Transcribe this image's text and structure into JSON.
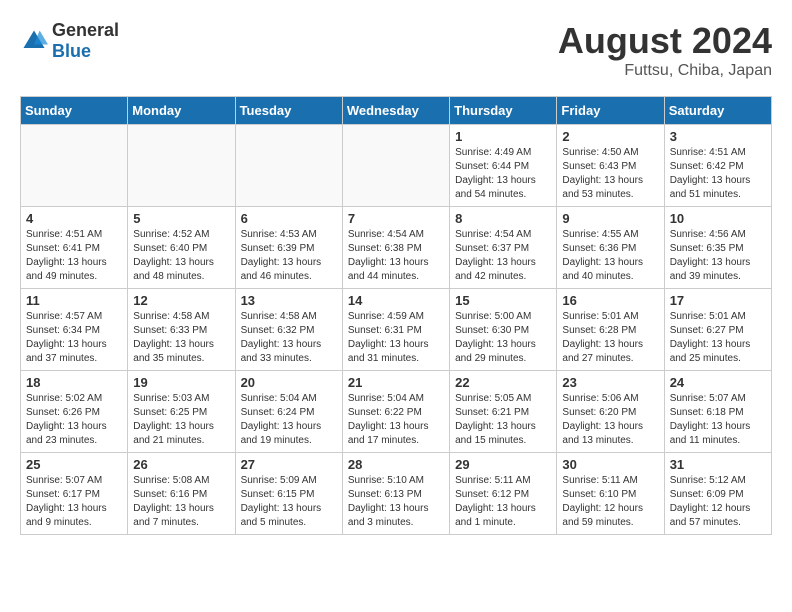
{
  "logo": {
    "general": "General",
    "blue": "Blue"
  },
  "title": "August 2024",
  "subtitle": "Futtsu, Chiba, Japan",
  "headers": [
    "Sunday",
    "Monday",
    "Tuesday",
    "Wednesday",
    "Thursday",
    "Friday",
    "Saturday"
  ],
  "weeks": [
    [
      {
        "day": "",
        "sunrise": "",
        "sunset": "",
        "daylight": ""
      },
      {
        "day": "",
        "sunrise": "",
        "sunset": "",
        "daylight": ""
      },
      {
        "day": "",
        "sunrise": "",
        "sunset": "",
        "daylight": ""
      },
      {
        "day": "",
        "sunrise": "",
        "sunset": "",
        "daylight": ""
      },
      {
        "day": "1",
        "sunrise": "Sunrise: 4:49 AM",
        "sunset": "Sunset: 6:44 PM",
        "daylight": "Daylight: 13 hours and 54 minutes."
      },
      {
        "day": "2",
        "sunrise": "Sunrise: 4:50 AM",
        "sunset": "Sunset: 6:43 PM",
        "daylight": "Daylight: 13 hours and 53 minutes."
      },
      {
        "day": "3",
        "sunrise": "Sunrise: 4:51 AM",
        "sunset": "Sunset: 6:42 PM",
        "daylight": "Daylight: 13 hours and 51 minutes."
      }
    ],
    [
      {
        "day": "4",
        "sunrise": "Sunrise: 4:51 AM",
        "sunset": "Sunset: 6:41 PM",
        "daylight": "Daylight: 13 hours and 49 minutes."
      },
      {
        "day": "5",
        "sunrise": "Sunrise: 4:52 AM",
        "sunset": "Sunset: 6:40 PM",
        "daylight": "Daylight: 13 hours and 48 minutes."
      },
      {
        "day": "6",
        "sunrise": "Sunrise: 4:53 AM",
        "sunset": "Sunset: 6:39 PM",
        "daylight": "Daylight: 13 hours and 46 minutes."
      },
      {
        "day": "7",
        "sunrise": "Sunrise: 4:54 AM",
        "sunset": "Sunset: 6:38 PM",
        "daylight": "Daylight: 13 hours and 44 minutes."
      },
      {
        "day": "8",
        "sunrise": "Sunrise: 4:54 AM",
        "sunset": "Sunset: 6:37 PM",
        "daylight": "Daylight: 13 hours and 42 minutes."
      },
      {
        "day": "9",
        "sunrise": "Sunrise: 4:55 AM",
        "sunset": "Sunset: 6:36 PM",
        "daylight": "Daylight: 13 hours and 40 minutes."
      },
      {
        "day": "10",
        "sunrise": "Sunrise: 4:56 AM",
        "sunset": "Sunset: 6:35 PM",
        "daylight": "Daylight: 13 hours and 39 minutes."
      }
    ],
    [
      {
        "day": "11",
        "sunrise": "Sunrise: 4:57 AM",
        "sunset": "Sunset: 6:34 PM",
        "daylight": "Daylight: 13 hours and 37 minutes."
      },
      {
        "day": "12",
        "sunrise": "Sunrise: 4:58 AM",
        "sunset": "Sunset: 6:33 PM",
        "daylight": "Daylight: 13 hours and 35 minutes."
      },
      {
        "day": "13",
        "sunrise": "Sunrise: 4:58 AM",
        "sunset": "Sunset: 6:32 PM",
        "daylight": "Daylight: 13 hours and 33 minutes."
      },
      {
        "day": "14",
        "sunrise": "Sunrise: 4:59 AM",
        "sunset": "Sunset: 6:31 PM",
        "daylight": "Daylight: 13 hours and 31 minutes."
      },
      {
        "day": "15",
        "sunrise": "Sunrise: 5:00 AM",
        "sunset": "Sunset: 6:30 PM",
        "daylight": "Daylight: 13 hours and 29 minutes."
      },
      {
        "day": "16",
        "sunrise": "Sunrise: 5:01 AM",
        "sunset": "Sunset: 6:28 PM",
        "daylight": "Daylight: 13 hours and 27 minutes."
      },
      {
        "day": "17",
        "sunrise": "Sunrise: 5:01 AM",
        "sunset": "Sunset: 6:27 PM",
        "daylight": "Daylight: 13 hours and 25 minutes."
      }
    ],
    [
      {
        "day": "18",
        "sunrise": "Sunrise: 5:02 AM",
        "sunset": "Sunset: 6:26 PM",
        "daylight": "Daylight: 13 hours and 23 minutes."
      },
      {
        "day": "19",
        "sunrise": "Sunrise: 5:03 AM",
        "sunset": "Sunset: 6:25 PM",
        "daylight": "Daylight: 13 hours and 21 minutes."
      },
      {
        "day": "20",
        "sunrise": "Sunrise: 5:04 AM",
        "sunset": "Sunset: 6:24 PM",
        "daylight": "Daylight: 13 hours and 19 minutes."
      },
      {
        "day": "21",
        "sunrise": "Sunrise: 5:04 AM",
        "sunset": "Sunset: 6:22 PM",
        "daylight": "Daylight: 13 hours and 17 minutes."
      },
      {
        "day": "22",
        "sunrise": "Sunrise: 5:05 AM",
        "sunset": "Sunset: 6:21 PM",
        "daylight": "Daylight: 13 hours and 15 minutes."
      },
      {
        "day": "23",
        "sunrise": "Sunrise: 5:06 AM",
        "sunset": "Sunset: 6:20 PM",
        "daylight": "Daylight: 13 hours and 13 minutes."
      },
      {
        "day": "24",
        "sunrise": "Sunrise: 5:07 AM",
        "sunset": "Sunset: 6:18 PM",
        "daylight": "Daylight: 13 hours and 11 minutes."
      }
    ],
    [
      {
        "day": "25",
        "sunrise": "Sunrise: 5:07 AM",
        "sunset": "Sunset: 6:17 PM",
        "daylight": "Daylight: 13 hours and 9 minutes."
      },
      {
        "day": "26",
        "sunrise": "Sunrise: 5:08 AM",
        "sunset": "Sunset: 6:16 PM",
        "daylight": "Daylight: 13 hours and 7 minutes."
      },
      {
        "day": "27",
        "sunrise": "Sunrise: 5:09 AM",
        "sunset": "Sunset: 6:15 PM",
        "daylight": "Daylight: 13 hours and 5 minutes."
      },
      {
        "day": "28",
        "sunrise": "Sunrise: 5:10 AM",
        "sunset": "Sunset: 6:13 PM",
        "daylight": "Daylight: 13 hours and 3 minutes."
      },
      {
        "day": "29",
        "sunrise": "Sunrise: 5:11 AM",
        "sunset": "Sunset: 6:12 PM",
        "daylight": "Daylight: 13 hours and 1 minute."
      },
      {
        "day": "30",
        "sunrise": "Sunrise: 5:11 AM",
        "sunset": "Sunset: 6:10 PM",
        "daylight": "Daylight: 12 hours and 59 minutes."
      },
      {
        "day": "31",
        "sunrise": "Sunrise: 5:12 AM",
        "sunset": "Sunset: 6:09 PM",
        "daylight": "Daylight: 12 hours and 57 minutes."
      }
    ]
  ]
}
